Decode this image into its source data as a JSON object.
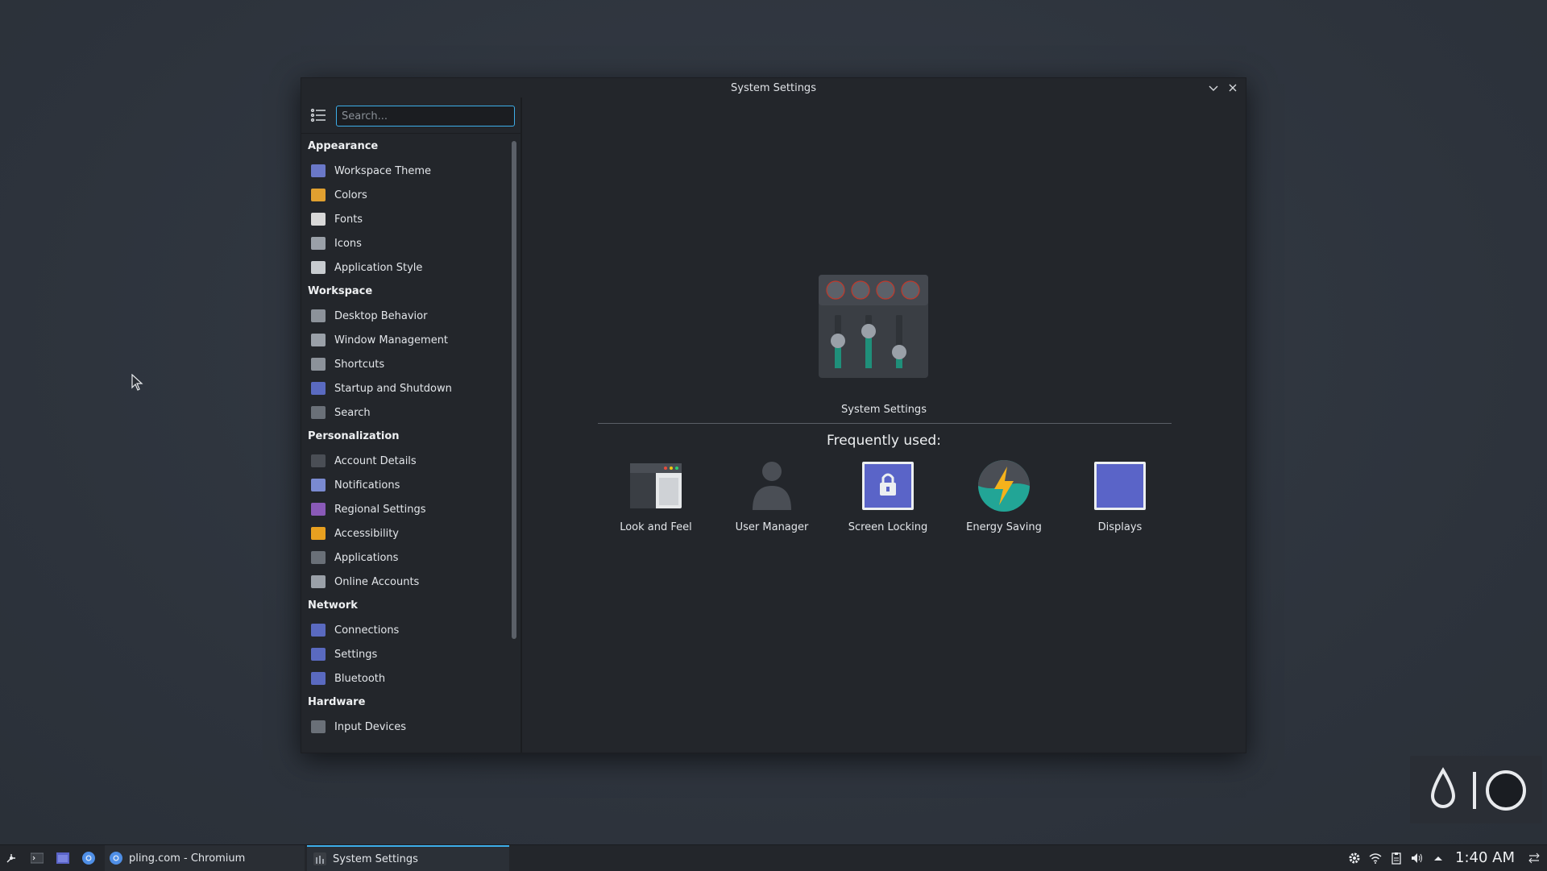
{
  "window": {
    "title": "System Settings",
    "minimize_icon": "chevron-down-icon",
    "close_icon": "close-icon"
  },
  "sidebar": {
    "menu_icon": "hamburger-list-icon",
    "search_placeholder": "Search...",
    "categories": [
      {
        "label": "Appearance",
        "items": [
          {
            "label": "Workspace Theme",
            "icon": "workspace-theme-icon",
            "color": "#6a78c8"
          },
          {
            "label": "Colors",
            "icon": "colors-icon",
            "color": "#e0a030"
          },
          {
            "label": "Fonts",
            "icon": "fonts-icon",
            "color": "#d8d8d8"
          },
          {
            "label": "Icons",
            "icon": "icons-icon",
            "color": "#9aa0a8"
          },
          {
            "label": "Application Style",
            "icon": "application-style-icon",
            "color": "#c8ccd0"
          }
        ]
      },
      {
        "label": "Workspace",
        "items": [
          {
            "label": "Desktop Behavior",
            "icon": "desktop-behavior-icon",
            "color": "#8c929a"
          },
          {
            "label": "Window Management",
            "icon": "window-management-icon",
            "color": "#9aa0a8"
          },
          {
            "label": "Shortcuts",
            "icon": "shortcuts-icon",
            "color": "#8c929a"
          },
          {
            "label": "Startup and Shutdown",
            "icon": "startup-shutdown-icon",
            "color": "#5a6ac0"
          },
          {
            "label": "Search",
            "icon": "search-icon",
            "color": "#6a7078"
          }
        ]
      },
      {
        "label": "Personalization",
        "items": [
          {
            "label": "Account Details",
            "icon": "account-details-icon",
            "color": "#4a4e55"
          },
          {
            "label": "Notifications",
            "icon": "notifications-icon",
            "color": "#7a8ad0"
          },
          {
            "label": "Regional Settings",
            "icon": "regional-settings-icon",
            "color": "#8a5ab8"
          },
          {
            "label": "Accessibility",
            "icon": "accessibility-icon",
            "color": "#e8a020"
          },
          {
            "label": "Applications",
            "icon": "applications-icon",
            "color": "#6a7078"
          },
          {
            "label": "Online Accounts",
            "icon": "online-accounts-icon",
            "color": "#9aa0a8"
          }
        ]
      },
      {
        "label": "Network",
        "items": [
          {
            "label": "Connections",
            "icon": "connections-icon",
            "color": "#5a6ac0"
          },
          {
            "label": "Settings",
            "icon": "network-settings-icon",
            "color": "#5a6ac0"
          },
          {
            "label": "Bluetooth",
            "icon": "bluetooth-icon",
            "color": "#5a6ac0"
          }
        ]
      },
      {
        "label": "Hardware",
        "items": [
          {
            "label": "Input Devices",
            "icon": "input-devices-icon",
            "color": "#6a7078"
          }
        ]
      }
    ]
  },
  "main": {
    "hero_icon": "system-settings-mixer-icon",
    "hero_label": "System Settings",
    "frequently_used_label": "Frequently used:",
    "tiles": [
      {
        "label": "Look and Feel",
        "icon": "look-and-feel-icon"
      },
      {
        "label": "User Manager",
        "icon": "user-manager-icon"
      },
      {
        "label": "Screen Locking",
        "icon": "screen-locking-icon"
      },
      {
        "label": "Energy Saving",
        "icon": "energy-saving-icon"
      },
      {
        "label": "Displays",
        "icon": "displays-icon"
      }
    ]
  },
  "taskbar": {
    "launchers": [
      "app-launcher-icon",
      "terminal-icon",
      "file-manager-icon",
      "chromium-icon"
    ],
    "tasks": [
      {
        "label": "pling.com - Chromium",
        "icon": "chromium-icon",
        "active": false
      },
      {
        "label": "System Settings",
        "icon": "system-settings-icon",
        "active": true
      }
    ],
    "tray": [
      "settings-gear-icon",
      "wifi-icon",
      "clipboard-icon",
      "volume-icon",
      "expand-tray-icon"
    ],
    "clock": "1:40 AM",
    "panel_menu_icon": "panel-options-icon"
  },
  "colors": {
    "accent": "#3daee9",
    "window_bg": "#23262b",
    "desktop_bg": "#2f3640"
  }
}
